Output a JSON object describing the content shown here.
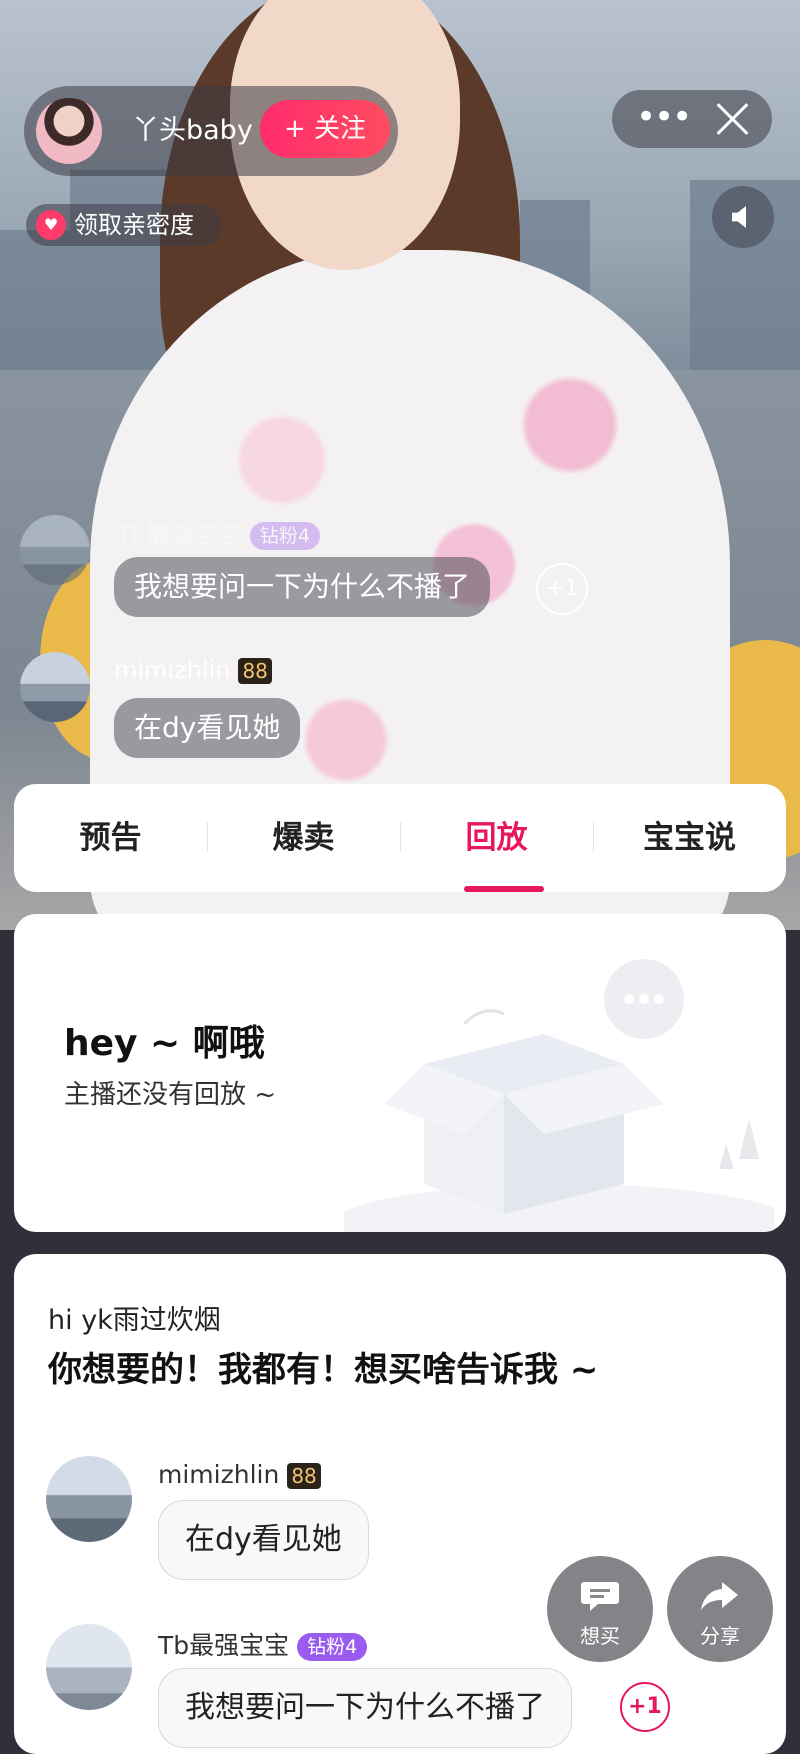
{
  "host": {
    "name": "丫头baby",
    "follow_label": "+ 关注"
  },
  "top_controls": {
    "more_label": "•••"
  },
  "intimacy": {
    "label": "领取亲密度"
  },
  "live_comments": [
    {
      "name": "Tb最强宝宝",
      "badge": "钻粉4",
      "text": "我想要问一下为什么不播了",
      "plus": "+1"
    },
    {
      "name": "mimizhlin",
      "badge": "88",
      "text": "在dy看见她"
    }
  ],
  "tabs": [
    {
      "label": "预告"
    },
    {
      "label": "爆卖"
    },
    {
      "label": "回放"
    },
    {
      "label": "宝宝说"
    }
  ],
  "active_tab": "回放",
  "empty_state": {
    "title": "hey ~ 啊哦",
    "subtitle": "主播还没有回放 ~"
  },
  "chat": {
    "greeting": "hi yk雨过炊烟",
    "slogan": "你想要的！我都有！想买啥告诉我 ~",
    "messages": [
      {
        "name": "mimizhlin",
        "badge": "88",
        "text": "在dy看见她"
      },
      {
        "name": "Tb最强宝宝",
        "badge": "钻粉4",
        "text": "我想要问一下为什么不播了",
        "plus": "+1"
      }
    ]
  },
  "fabs": {
    "want_buy": "想买",
    "share": "分享"
  },
  "colors": {
    "accent": "#e6175b",
    "follow": "#ff2c6b",
    "diamond_badge": "#9a5cf0"
  }
}
